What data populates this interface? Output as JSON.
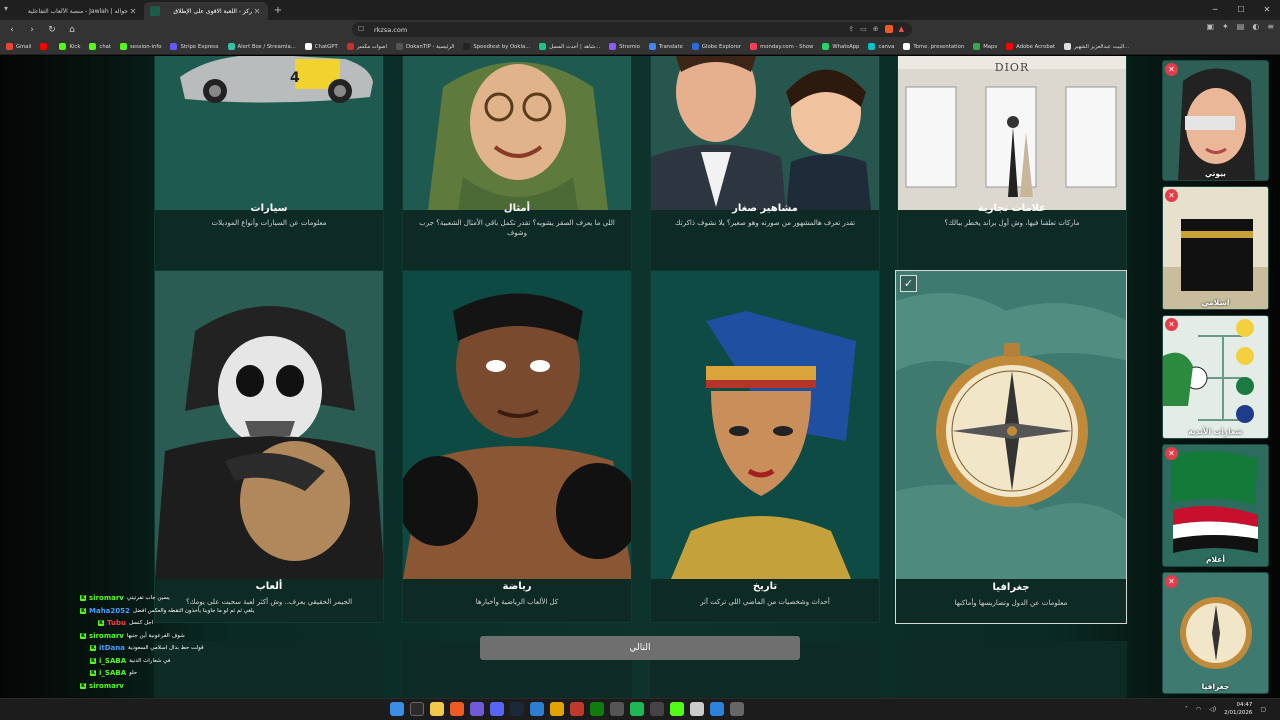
{
  "browser": {
    "tabs": [
      {
        "title": "جواله | Jawlah - منصة الألعاب التفاعلية",
        "active": false
      },
      {
        "title": "ركز - اللعبة الاقوى على الإطلاق",
        "active": true
      }
    ],
    "url": "rkzsa.com",
    "bookmarks": [
      {
        "label": "Gmail",
        "color": "#ea4335"
      },
      {
        "label": "",
        "color": "#ff0000"
      },
      {
        "label": "Kick",
        "color": "#53fc18"
      },
      {
        "label": "chat",
        "color": "#53fc18"
      },
      {
        "label": "session-info",
        "color": "#53fc18"
      },
      {
        "label": "Stripe Express",
        "color": "#635bff"
      },
      {
        "label": "Alert Box / Streamla...",
        "color": "#31c3a2"
      },
      {
        "label": "ChatGPT",
        "color": "#ffffff"
      },
      {
        "label": "اصوات مكسر",
        "color": "#c9302c"
      },
      {
        "label": "DokanTIP - الرئيسية",
        "color": "#555555"
      },
      {
        "label": "Speedtest by Ookla...",
        "color": "#222222"
      },
      {
        "label": "شاهد | أحدث المسل...",
        "color": "#16c784"
      },
      {
        "label": "Stremio",
        "color": "#8a5cf5"
      },
      {
        "label": "Translate",
        "color": "#4285f4"
      },
      {
        "label": "Globe Explorer",
        "color": "#2d6cdf"
      },
      {
        "label": "monday.com - Show",
        "color": "#ff3d57"
      },
      {
        "label": "WhatsApp",
        "color": "#25d366"
      },
      {
        "label": "canva",
        "color": "#00c4cc"
      },
      {
        "label": "Tome. presentation",
        "color": "#ffffff"
      },
      {
        "label": "Maps",
        "color": "#34a853"
      },
      {
        "label": "Adobe Acrobat",
        "color": "#ff0000"
      },
      {
        "label": "البيت عبدالعزيز الشهير...",
        "color": "#e0e0e0"
      }
    ]
  },
  "categories_top": [
    {
      "title": "سيارات",
      "desc": "معلومات عن السيارات وأنواع الموديلات"
    },
    {
      "title": "أمثال",
      "desc": "اللي ما يعرف الصقر يشويه؟ تقدر تكمل باقي الأمثال الشعبية؟ جرب وشوف"
    },
    {
      "title": "مشاهير صغار",
      "desc": "تقدر تعرف هالمشهور من صورته وهو صغير؟ يلا نشوف ذاكرتك"
    },
    {
      "title": "علامات تجارية",
      "desc": "ماركات تعلقنا فيها، وش أول براند يخطر ببالك؟",
      "store_sign": "DIOR"
    }
  ],
  "categories_main": [
    {
      "title": "ألعاب",
      "desc": "الجيمر الحقيقي يعرف.. وش أكثر لعبة سحبت على يومك؟"
    },
    {
      "title": "رياضة",
      "desc": "كل الألعاب الرياضية وأخبارها"
    },
    {
      "title": "تاريخ",
      "desc": "أحداث وشخصيات من الماضي اللي تركت آثر"
    },
    {
      "title": "جغرافيا",
      "desc": "معلومات عن الدول وتضاريسها وأماكنها",
      "selected": true
    }
  ],
  "selected_panel": [
    {
      "label": "بيوتي"
    },
    {
      "label": "اسلامي"
    },
    {
      "label": "شعارات الأندية"
    },
    {
      "label": "أعلام"
    },
    {
      "label": "جغرافيا"
    }
  ],
  "next_button": "التالي",
  "chat": [
    {
      "user": "siromarv",
      "color": "#53fc18",
      "msg": "يسين جاب تفرتيتي"
    },
    {
      "user": "Maha2052",
      "color": "#4a9cff",
      "msg": "يلغي ثم ثم لو ما جاوبنا يأخذون النقطه والعكس افضل"
    },
    {
      "user": "Tubu",
      "color": "#ff3c3c",
      "msg": "اجل كنسل"
    },
    {
      "user": "siromarv",
      "color": "#53fc18",
      "msg": "شوف الفرعونية أين جتبها"
    },
    {
      "user": "itDana",
      "color": "#4a9cff",
      "msg": "قولت حط بدال اسلامي السعودية"
    },
    {
      "user": "i_SABA",
      "color": "#53fc18",
      "msg": "في شعارات الدنية"
    },
    {
      "user": "i_SABA",
      "color": "#53fc18",
      "msg": "حلو"
    },
    {
      "user": "siromarv",
      "color": "#53fc18",
      "msg": ""
    }
  ],
  "taskbar": {
    "time": "04:47",
    "date": "2/01/2026"
  }
}
